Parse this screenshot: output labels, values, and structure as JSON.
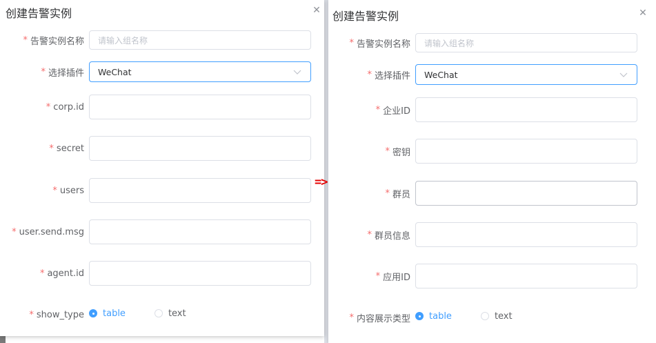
{
  "arrow_text": "=>",
  "left": {
    "title": "创建告警实例",
    "fields": [
      {
        "label": "告警实例名称",
        "placeholder": "请输入组名称",
        "value": ""
      },
      {
        "label": "选择插件",
        "value": "WeChat"
      },
      {
        "label": "corp.id",
        "value": ""
      },
      {
        "label": "secret",
        "value": ""
      },
      {
        "label": "users",
        "value": ""
      },
      {
        "label": "user.send.msg",
        "value": ""
      },
      {
        "label": "agent.id",
        "value": ""
      },
      {
        "label": "show_type",
        "options": [
          "table",
          "text"
        ],
        "selected": "table"
      }
    ]
  },
  "right": {
    "title": "创建告警实例",
    "fields": [
      {
        "label": "告警实例名称",
        "placeholder": "请输入组名称",
        "value": ""
      },
      {
        "label": "选择插件",
        "value": "WeChat"
      },
      {
        "label": "企业ID",
        "value": ""
      },
      {
        "label": "密钥",
        "value": ""
      },
      {
        "label": "群员",
        "value": ""
      },
      {
        "label": "群员信息",
        "value": ""
      },
      {
        "label": "应用ID",
        "value": ""
      },
      {
        "label": "内容展示类型",
        "options": [
          "table",
          "text"
        ],
        "selected": "table"
      }
    ]
  },
  "colors": {
    "required": "#f56c6c",
    "accent": "#409eff",
    "arrow": "#e60000"
  }
}
